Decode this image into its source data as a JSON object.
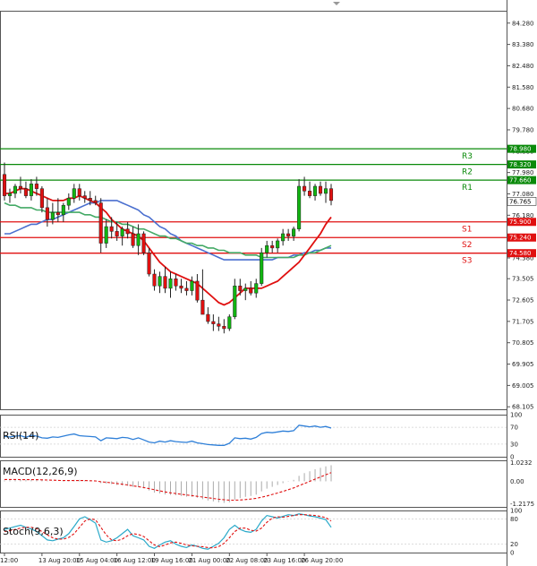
{
  "chart_data": {
    "type": "candlestick",
    "main": {
      "ylim": [
        68.0,
        84.8
      ],
      "y_ticks": [
        "84.280",
        "83.380",
        "82.480",
        "81.580",
        "80.680",
        "79.780",
        "78.880",
        "77.980",
        "77.080",
        "76.180",
        "75.280",
        "74.380",
        "73.505",
        "72.605",
        "71.705",
        "70.805",
        "69.905",
        "69.005",
        "68.105"
      ],
      "current_price": "76.765",
      "current_price_value": 76.765,
      "levels": [
        {
          "name": "R3",
          "value": 78.98,
          "label": "78.980",
          "color": "#0a8a0a"
        },
        {
          "name": "R2",
          "value": 78.32,
          "label": "78.320",
          "color": "#0a8a0a"
        },
        {
          "name": "R1",
          "value": 77.66,
          "label": "77.660",
          "color": "#0a8a0a"
        },
        {
          "name": "S1",
          "value": 75.9,
          "label": "75.900",
          "color": "#e01010"
        },
        {
          "name": "S2",
          "value": 75.24,
          "label": "75.240",
          "color": "#e01010"
        },
        {
          "name": "S3",
          "value": 74.58,
          "label": "74.580",
          "color": "#e01010"
        }
      ],
      "candles": [
        [
          77.9,
          78.4,
          76.8,
          77.0
        ],
        [
          77.0,
          77.3,
          76.7,
          77.1
        ],
        [
          77.1,
          77.5,
          76.9,
          77.4
        ],
        [
          77.4,
          77.8,
          77.1,
          77.3
        ],
        [
          77.3,
          77.6,
          76.9,
          77.0
        ],
        [
          77.0,
          77.7,
          76.8,
          77.5
        ],
        [
          77.5,
          77.8,
          77.0,
          77.3
        ],
        [
          77.3,
          77.4,
          76.3,
          76.5
        ],
        [
          76.5,
          76.9,
          75.7,
          76.0
        ],
        [
          76.0,
          76.7,
          75.8,
          76.3
        ],
        [
          76.3,
          76.9,
          75.9,
          76.2
        ],
        [
          76.2,
          76.7,
          75.9,
          76.6
        ],
        [
          76.6,
          77.1,
          76.4,
          76.9
        ],
        [
          76.9,
          77.5,
          76.7,
          77.3
        ],
        [
          77.3,
          77.5,
          76.8,
          77.0
        ],
        [
          77.0,
          77.2,
          76.7,
          76.9
        ],
        [
          76.9,
          77.2,
          76.6,
          76.8
        ],
        [
          76.8,
          77.0,
          76.6,
          76.7
        ],
        [
          76.7,
          76.9,
          74.6,
          75.0
        ],
        [
          75.0,
          76.0,
          74.8,
          75.7
        ],
        [
          75.7,
          76.1,
          75.2,
          75.5
        ],
        [
          75.5,
          75.9,
          75.1,
          75.3
        ],
        [
          75.3,
          75.7,
          74.9,
          75.6
        ],
        [
          75.6,
          75.9,
          75.2,
          75.4
        ],
        [
          75.4,
          75.7,
          74.8,
          74.9
        ],
        [
          74.9,
          75.8,
          74.5,
          75.4
        ],
        [
          75.4,
          75.5,
          74.5,
          74.6
        ],
        [
          74.6,
          74.8,
          73.6,
          73.7
        ],
        [
          73.7,
          73.9,
          73.0,
          73.2
        ],
        [
          73.2,
          73.8,
          72.9,
          73.6
        ],
        [
          73.6,
          74.0,
          72.9,
          73.1
        ],
        [
          73.1,
          73.8,
          72.7,
          73.5
        ],
        [
          73.5,
          73.7,
          73.0,
          73.2
        ],
        [
          73.2,
          73.5,
          72.9,
          73.1
        ],
        [
          73.1,
          73.4,
          72.8,
          73.0
        ],
        [
          73.0,
          73.6,
          72.8,
          73.4
        ],
        [
          73.4,
          73.7,
          72.5,
          72.6
        ],
        [
          72.6,
          73.9,
          72.4,
          72.0
        ],
        [
          72.0,
          72.3,
          71.6,
          71.7
        ],
        [
          71.7,
          72.0,
          71.3,
          71.6
        ],
        [
          71.6,
          71.9,
          71.3,
          71.5
        ],
        [
          71.5,
          71.8,
          71.2,
          71.4
        ],
        [
          71.4,
          72.0,
          71.3,
          71.9
        ],
        [
          71.9,
          73.5,
          71.8,
          73.2
        ],
        [
          73.2,
          73.5,
          72.8,
          73.0
        ],
        [
          73.0,
          73.3,
          72.6,
          73.1
        ],
        [
          73.1,
          73.4,
          72.8,
          72.9
        ],
        [
          72.9,
          73.5,
          72.7,
          73.3
        ],
        [
          73.3,
          74.8,
          73.2,
          74.6
        ],
        [
          74.6,
          75.1,
          74.4,
          74.9
        ],
        [
          74.9,
          75.1,
          74.6,
          74.8
        ],
        [
          74.8,
          75.2,
          74.6,
          75.1
        ],
        [
          75.1,
          75.6,
          74.9,
          75.4
        ],
        [
          75.4,
          75.6,
          75.1,
          75.3
        ],
        [
          75.3,
          75.7,
          75.1,
          75.6
        ],
        [
          75.6,
          77.7,
          75.5,
          77.4
        ],
        [
          77.4,
          77.8,
          77.0,
          77.2
        ],
        [
          77.2,
          77.6,
          76.9,
          77.0
        ],
        [
          77.0,
          77.5,
          76.8,
          77.4
        ],
        [
          77.4,
          77.6,
          77.0,
          77.1
        ],
        [
          77.1,
          77.6,
          76.7,
          77.3
        ],
        [
          77.3,
          77.5,
          76.6,
          76.8
        ]
      ],
      "ma_red": [
        77.1,
        77.1,
        77.2,
        77.3,
        77.3,
        77.2,
        77.1,
        77.0,
        76.9,
        76.8,
        76.8,
        76.8,
        76.9,
        76.9,
        77.0,
        76.9,
        76.8,
        76.7,
        76.5,
        76.3,
        76.0,
        75.8,
        75.6,
        75.5,
        75.4,
        75.3,
        75.1,
        74.8,
        74.5,
        74.2,
        74.0,
        73.8,
        73.7,
        73.6,
        73.5,
        73.4,
        73.3,
        73.1,
        72.9,
        72.7,
        72.5,
        72.4,
        72.5,
        72.7,
        72.9,
        73.1,
        73.1,
        73.1,
        73.1,
        73.2,
        73.3,
        73.4,
        73.6,
        73.8,
        74.0,
        74.2,
        74.5,
        74.8,
        75.1,
        75.4,
        75.8,
        76.1
      ],
      "ma_green": [
        76.7,
        76.6,
        76.6,
        76.5,
        76.5,
        76.5,
        76.4,
        76.4,
        76.3,
        76.3,
        76.3,
        76.3,
        76.3,
        76.3,
        76.3,
        76.2,
        76.2,
        76.1,
        76.1,
        76.0,
        75.9,
        75.9,
        75.8,
        75.8,
        75.7,
        75.6,
        75.6,
        75.5,
        75.4,
        75.3,
        75.3,
        75.2,
        75.2,
        75.1,
        75.0,
        75.0,
        74.9,
        74.9,
        74.8,
        74.8,
        74.7,
        74.7,
        74.6,
        74.6,
        74.6,
        74.5,
        74.5,
        74.5,
        74.4,
        74.4,
        74.4,
        74.4,
        74.4,
        74.4,
        74.4,
        74.5,
        74.5,
        74.6,
        74.6,
        74.7,
        74.8,
        74.9
      ],
      "ma_blue": [
        75.4,
        75.4,
        75.5,
        75.6,
        75.7,
        75.8,
        75.8,
        75.9,
        76.0,
        76.0,
        76.1,
        76.2,
        76.3,
        76.4,
        76.5,
        76.6,
        76.7,
        76.7,
        76.8,
        76.8,
        76.8,
        76.8,
        76.7,
        76.6,
        76.5,
        76.4,
        76.2,
        76.1,
        75.9,
        75.7,
        75.6,
        75.4,
        75.3,
        75.1,
        75.0,
        74.9,
        74.8,
        74.7,
        74.6,
        74.5,
        74.4,
        74.3,
        74.3,
        74.3,
        74.3,
        74.3,
        74.3,
        74.3,
        74.3,
        74.3,
        74.3,
        74.4,
        74.4,
        74.4,
        74.5,
        74.5,
        74.6,
        74.6,
        74.7,
        74.7,
        74.8,
        74.8
      ]
    },
    "rsi": {
      "label": "RSI(14)",
      "ylim": [
        0,
        100
      ],
      "ticks": [
        "100",
        "70",
        "30",
        "0"
      ],
      "tick_values": [
        100,
        70,
        30,
        0
      ],
      "values": [
        48,
        47,
        49,
        50,
        46,
        51,
        49,
        45,
        44,
        47,
        46,
        49,
        52,
        54,
        50,
        49,
        48,
        47,
        38,
        45,
        44,
        43,
        46,
        45,
        41,
        45,
        40,
        35,
        33,
        37,
        35,
        38,
        36,
        35,
        34,
        37,
        33,
        31,
        29,
        28,
        27,
        27,
        32,
        45,
        43,
        44,
        42,
        46,
        55,
        58,
        57,
        59,
        61,
        60,
        62,
        75,
        73,
        71,
        73,
        70,
        72,
        68
      ]
    },
    "macd": {
      "label": "MACD(12,26,9)",
      "ylim": [
        -1.4,
        1.15
      ],
      "ticks": [
        "1.0232",
        "0.00",
        "-1.2175"
      ],
      "tick_values": [
        1.0232,
        0.0,
        -1.2175
      ],
      "histogram": [
        0.05,
        0.06,
        0.08,
        0.1,
        0.09,
        0.1,
        0.1,
        0.07,
        0.02,
        0.01,
        0.0,
        0.02,
        0.05,
        0.08,
        0.08,
        0.06,
        0.05,
        0.03,
        -0.1,
        -0.12,
        -0.15,
        -0.2,
        -0.22,
        -0.25,
        -0.3,
        -0.32,
        -0.38,
        -0.5,
        -0.62,
        -0.66,
        -0.72,
        -0.74,
        -0.76,
        -0.8,
        -0.84,
        -0.85,
        -0.9,
        -0.98,
        -1.05,
        -1.1,
        -1.15,
        -1.18,
        -1.15,
        -1.0,
        -0.92,
        -0.85,
        -0.8,
        -0.73,
        -0.55,
        -0.4,
        -0.3,
        -0.2,
        -0.1,
        -0.02,
        0.08,
        0.3,
        0.45,
        0.55,
        0.66,
        0.74,
        0.82,
        0.88
      ],
      "signal": [
        0.1,
        0.1,
        0.1,
        0.09,
        0.09,
        0.09,
        0.09,
        0.08,
        0.07,
        0.06,
        0.05,
        0.04,
        0.04,
        0.04,
        0.04,
        0.04,
        0.03,
        0.02,
        -0.02,
        -0.05,
        -0.08,
        -0.12,
        -0.16,
        -0.2,
        -0.25,
        -0.29,
        -0.34,
        -0.4,
        -0.46,
        -0.52,
        -0.58,
        -0.63,
        -0.67,
        -0.71,
        -0.75,
        -0.78,
        -0.82,
        -0.86,
        -0.9,
        -0.94,
        -0.98,
        -1.01,
        -1.03,
        -1.03,
        -1.02,
        -1.0,
        -0.97,
        -0.93,
        -0.87,
        -0.8,
        -0.72,
        -0.64,
        -0.55,
        -0.46,
        -0.36,
        -0.24,
        -0.12,
        0.0,
        0.12,
        0.24,
        0.36,
        0.48
      ]
    },
    "stoch": {
      "label": "Stoch(9,6,3)",
      "ylim": [
        0,
        100
      ],
      "ticks": [
        "100",
        "80",
        "20",
        "0"
      ],
      "tick_values": [
        100,
        80,
        20,
        0
      ],
      "k": [
        55,
        58,
        62,
        65,
        60,
        56,
        50,
        40,
        30,
        28,
        32,
        35,
        45,
        62,
        80,
        85,
        78,
        70,
        30,
        25,
        28,
        35,
        45,
        55,
        40,
        35,
        30,
        15,
        10,
        18,
        25,
        28,
        20,
        15,
        12,
        18,
        15,
        10,
        8,
        15,
        22,
        35,
        55,
        65,
        55,
        50,
        48,
        55,
        75,
        88,
        85,
        82,
        86,
        90,
        88,
        92,
        90,
        87,
        85,
        82,
        78,
        60
      ],
      "d": [
        50,
        52,
        55,
        58,
        60,
        60,
        57,
        50,
        42,
        35,
        32,
        32,
        36,
        45,
        60,
        75,
        80,
        78,
        60,
        42,
        30,
        28,
        32,
        40,
        45,
        43,
        38,
        28,
        18,
        14,
        18,
        23,
        25,
        22,
        18,
        16,
        15,
        14,
        12,
        11,
        14,
        22,
        35,
        50,
        58,
        58,
        53,
        51,
        58,
        72,
        82,
        85,
        84,
        86,
        88,
        90,
        90,
        89,
        88,
        86,
        83,
        75
      ]
    },
    "x_axis": {
      "labels": [
        "12:00",
        "13 Aug 20:00",
        "15 Aug 04:00",
        "16 Aug 12:00",
        "19 Aug 16:00",
        "21 Aug 00:00",
        "22 Aug 08:00",
        "23 Aug 16:00",
        "26 Aug 20:00"
      ],
      "label_indices": [
        0,
        7,
        14,
        21,
        28,
        35,
        42,
        49,
        56
      ]
    },
    "colors": {
      "bull": "#11b611",
      "bear": "#e01010",
      "ma_red": "#e01010",
      "ma_green": "#44aa66",
      "ma_blue": "#4a6fcf",
      "rsi_line": "#2e7fd8",
      "macd_signal": "#e01010",
      "macd_hist": "#aaaaaa",
      "stoch_k": "#2aa9c9",
      "stoch_d": "#e01010"
    }
  }
}
